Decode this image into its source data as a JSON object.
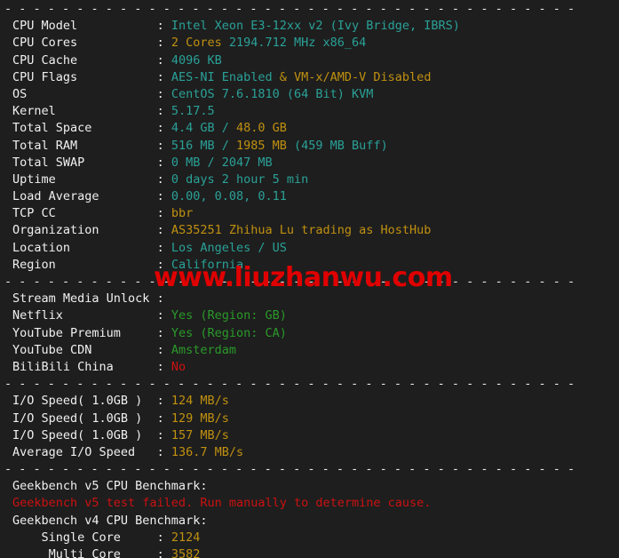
{
  "terminal": {
    "separator": "- - - - - - - - - - - - - - - - - - - - - - - - - - - - - - - - - - - - - - - -",
    "colon": ":",
    "watermark": "www.liuzhanwu.com",
    "colors": {
      "background": "#1e1e1e",
      "label": "#f0f0f0",
      "teal": "#2aa198",
      "gold": "#c09010",
      "green": "#2a9a2a",
      "red": "#cc1111",
      "watermark": "#e00000"
    }
  },
  "system": {
    "rows": [
      {
        "label": "CPU Model",
        "parts": [
          {
            "text": "Intel Xeon E3-12xx v2 (Ivy Bridge, IBRS)",
            "color": "teal"
          }
        ]
      },
      {
        "label": "CPU Cores",
        "parts": [
          {
            "text": "2 Cores",
            "color": "gold"
          },
          {
            "text": " 2194.712 MHz x86_64",
            "color": "teal"
          }
        ]
      },
      {
        "label": "CPU Cache",
        "parts": [
          {
            "text": "4096 KB",
            "color": "teal"
          }
        ]
      },
      {
        "label": "CPU Flags",
        "parts": [
          {
            "text": "AES-NI Enabled",
            "color": "teal"
          },
          {
            "text": " & ",
            "color": "gold"
          },
          {
            "text": "VM-x/AMD-V Disabled",
            "color": "gold"
          }
        ]
      },
      {
        "label": "OS",
        "parts": [
          {
            "text": "CentOS 7.6.1810 (64 Bit) KVM",
            "color": "teal"
          }
        ]
      },
      {
        "label": "Kernel",
        "parts": [
          {
            "text": "5.17.5",
            "color": "teal"
          }
        ]
      },
      {
        "label": "Total Space",
        "parts": [
          {
            "text": "4.4 GB",
            "color": "teal"
          },
          {
            "text": " / ",
            "color": "teal"
          },
          {
            "text": "48.0 GB",
            "color": "gold"
          }
        ]
      },
      {
        "label": "Total RAM",
        "parts": [
          {
            "text": "516 MB",
            "color": "teal"
          },
          {
            "text": " / ",
            "color": "teal"
          },
          {
            "text": "1985 MB",
            "color": "gold"
          },
          {
            "text": " (459 MB Buff)",
            "color": "teal"
          }
        ]
      },
      {
        "label": "Total SWAP",
        "parts": [
          {
            "text": "0 MB",
            "color": "teal"
          },
          {
            "text": " / 2047 MB",
            "color": "teal"
          }
        ]
      },
      {
        "label": "Uptime",
        "parts": [
          {
            "text": "0 days 2 hour 5 min",
            "color": "teal"
          }
        ]
      },
      {
        "label": "Load Average",
        "parts": [
          {
            "text": "0.00, 0.08, 0.11",
            "color": "teal"
          }
        ]
      },
      {
        "label": "TCP CC",
        "parts": [
          {
            "text": "bbr",
            "color": "gold"
          }
        ]
      },
      {
        "label": "Organization",
        "parts": [
          {
            "text": "AS35251 Zhihua Lu trading as HostHub",
            "color": "gold"
          }
        ]
      },
      {
        "label": "Location",
        "parts": [
          {
            "text": "Los Angeles / US",
            "color": "teal"
          }
        ]
      },
      {
        "label": "Region",
        "parts": [
          {
            "text": "California",
            "color": "teal"
          }
        ]
      }
    ]
  },
  "stream_media": {
    "heading": "Stream Media Unlock",
    "rows": [
      {
        "label": "Netflix",
        "parts": [
          {
            "text": "Yes (Region: GB)",
            "color": "green"
          }
        ]
      },
      {
        "label": "YouTube Premium",
        "parts": [
          {
            "text": "Yes (Region: CA)",
            "color": "green"
          }
        ]
      },
      {
        "label": "YouTube CDN",
        "parts": [
          {
            "text": "Amsterdam",
            "color": "green"
          }
        ]
      },
      {
        "label": "BiliBili China",
        "parts": [
          {
            "text": "No",
            "color": "red"
          }
        ]
      }
    ]
  },
  "io_speed": {
    "rows": [
      {
        "label": "I/O Speed( 1.0GB )",
        "parts": [
          {
            "text": "124 MB/s",
            "color": "gold"
          }
        ]
      },
      {
        "label": "I/O Speed( 1.0GB )",
        "parts": [
          {
            "text": "129 MB/s",
            "color": "gold"
          }
        ]
      },
      {
        "label": "I/O Speed( 1.0GB )",
        "parts": [
          {
            "text": "157 MB/s",
            "color": "gold"
          }
        ]
      },
      {
        "label": "Average I/O Speed",
        "parts": [
          {
            "text": "136.7 MB/s",
            "color": "gold"
          }
        ]
      }
    ]
  },
  "geekbench": {
    "v5_heading": "Geekbench v5 CPU Benchmark:",
    "v5_error": "Geekbench v5 test failed. Run manually to determine cause.",
    "v4_heading": "Geekbench v4 CPU Benchmark:",
    "rows": [
      {
        "label": "Single Core",
        "parts": [
          {
            "text": "2124",
            "color": "gold"
          }
        ]
      },
      {
        "label": "Multi Core",
        "parts": [
          {
            "text": "3582",
            "color": "gold"
          }
        ]
      }
    ]
  }
}
